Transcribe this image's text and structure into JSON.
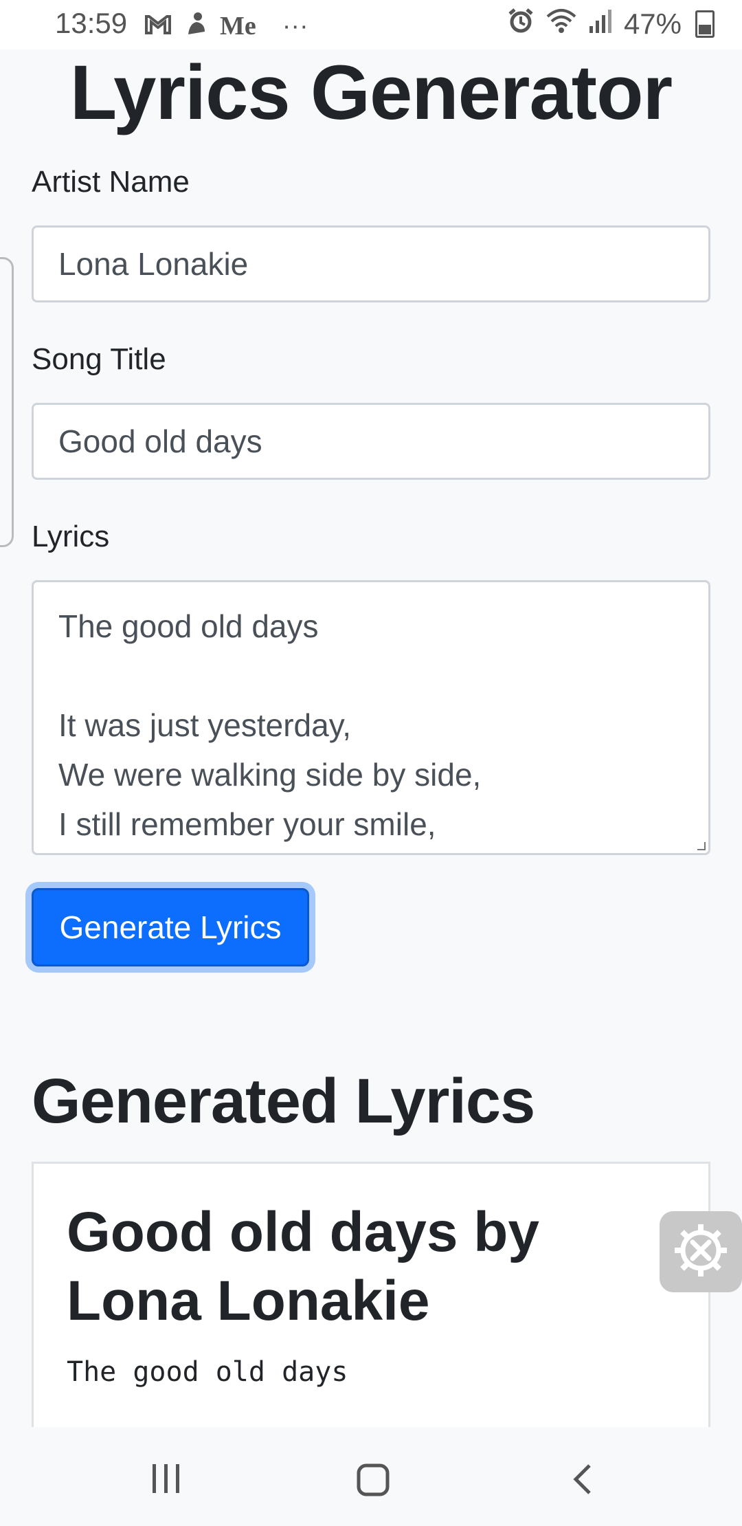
{
  "status_bar": {
    "time": "13:59",
    "left_icons": [
      "gmail-icon",
      "notification-icon",
      "me-app-icon",
      "more-icon"
    ],
    "me_text": "Me",
    "more_text": "···",
    "battery_percent": "47%"
  },
  "page": {
    "title": "Lyrics Generator"
  },
  "form": {
    "artist_label": "Artist Name",
    "artist_value": "Lona Lonakie",
    "title_label": "Song Title",
    "title_value": "Good old days",
    "lyrics_label": "Lyrics",
    "lyrics_lines": [
      "The good old days",
      "",
      "It was just yesterday,",
      "We were walking side by side,",
      "I still remember your smile,"
    ],
    "generate_label": "Generate Lyrics"
  },
  "output": {
    "section_title": "Generated Lyrics",
    "card_title": "Good old days by Lona Lonakie",
    "card_first_line": "The good old days"
  },
  "colors": {
    "primary": "#0d6efd",
    "background": "#f8f9fa"
  }
}
